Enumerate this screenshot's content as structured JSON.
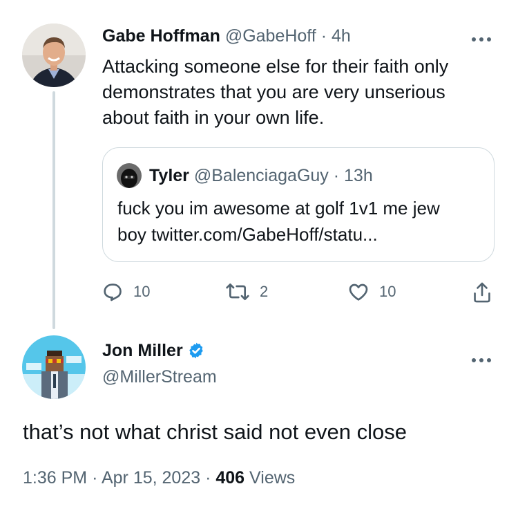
{
  "parent_tweet": {
    "author_name": "Gabe Hoffman",
    "handle": "@GabeHoff",
    "separator": "·",
    "time": "4h",
    "text_line1": "Attacking someone else for their faith only",
    "text_line2": "demonstrates that you are very unserious",
    "text_line3": "about faith in your own life.",
    "quoted": {
      "author_name": "Tyler",
      "handle": "@BalenciagaGuy",
      "separator": "·",
      "time": "13h",
      "text_line1": "fuck you im awesome at golf 1v1 me jew",
      "text_line2": "boy twitter.com/GabeHoff/statu..."
    },
    "actions": {
      "replies": "10",
      "retweets": "2",
      "likes": "10"
    }
  },
  "main_tweet": {
    "author_name": "Jon Miller",
    "handle": "@MillerStream",
    "verified": true,
    "text": "that’s not what christ said not even close",
    "time": "1:36 PM",
    "separator": "·",
    "date": "Apr 15, 2023",
    "views_count": "406",
    "views_label": "Views"
  },
  "colors": {
    "text": "#0f1419",
    "muted": "#536471",
    "border": "#cfd9de",
    "verified": "#1d9bf0"
  },
  "icons": {
    "more": "more-dots-icon",
    "reply": "reply-icon",
    "retweet": "retweet-icon",
    "like": "heart-icon",
    "share": "share-icon",
    "verified": "verified-badge-icon"
  }
}
